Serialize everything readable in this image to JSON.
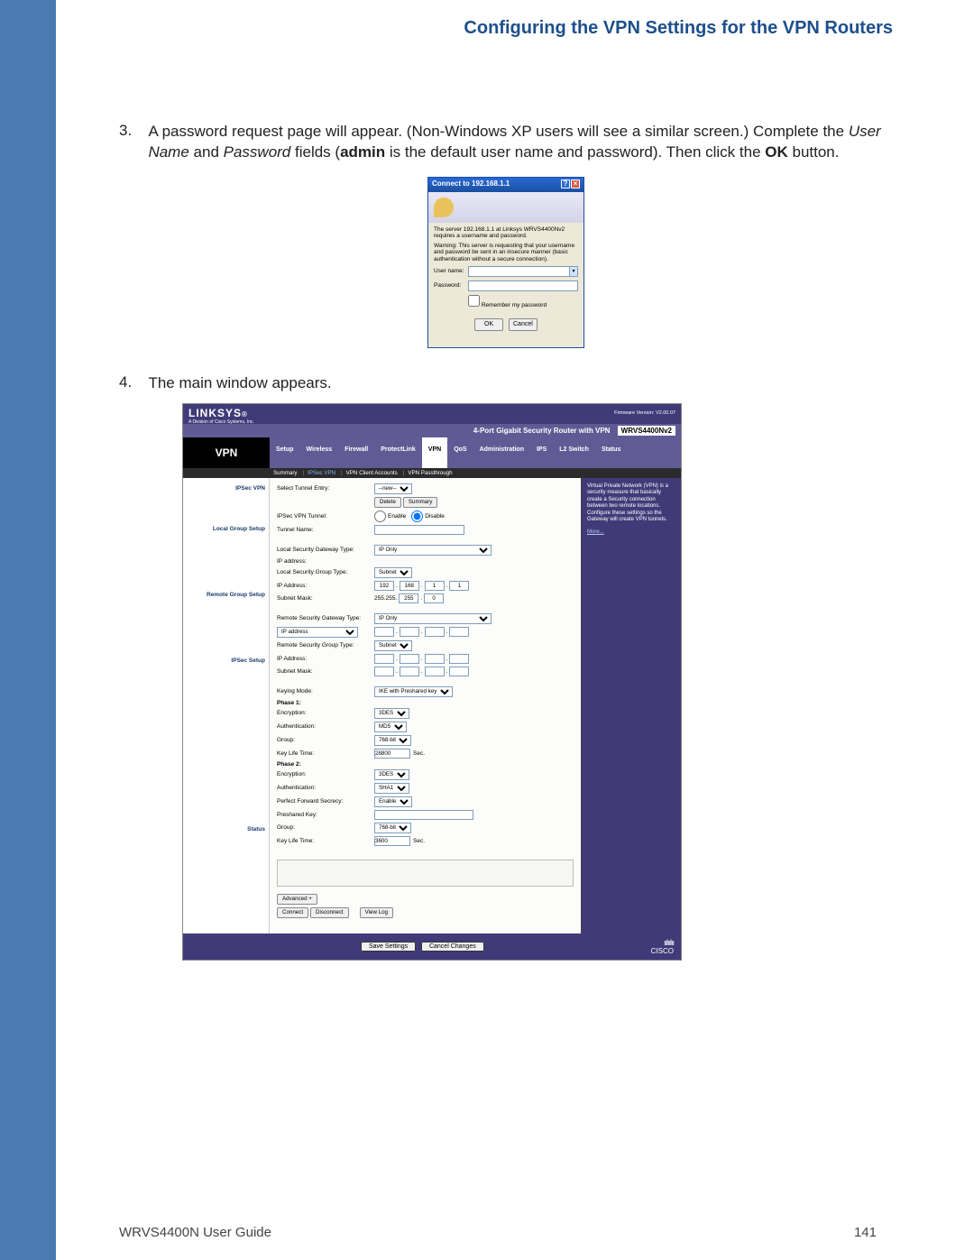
{
  "header": {
    "left": "",
    "right": "Configuring the VPN Settings for the VPN Routers"
  },
  "step3": {
    "num": "3.",
    "html": "A password request page will appear. (Non-Windows XP users will see a similar screen.) Complete the <i>User Name</i> and <i>Password</i> fields (<b>admin</b> is the default user name and password). Then click the <b>OK</b> button."
  },
  "xpdlg": {
    "title": "Connect to 192.168.1.1",
    "msg1": "The server 192.168.1.1 at Linksys WRVS4400Nv2 requires a username and password.",
    "msg2": "Warning: This server is requesting that your username and password be sent in an insecure manner (basic authentication without a secure connection).",
    "user_lbl": "User name:",
    "pass_lbl": "Password:",
    "remember": "Remember my password",
    "ok": "OK",
    "cancel": "Cancel"
  },
  "step4": {
    "num": "4.",
    "text": "The main window appears."
  },
  "router": {
    "brand": "LINKSYS",
    "brand_sub": "A Division of Cisco Systems, Inc.",
    "firmware": "Firmware Version: V2.00.07",
    "title": "4-Port Gigabit Security Router with VPN",
    "model": "WRVS4400Nv2",
    "logo": "VPN",
    "tabs": [
      "Setup",
      "Wireless",
      "Firewall",
      "ProtectLink",
      "VPN",
      "QoS",
      "Administration",
      "IPS",
      "L2 Switch",
      "Status"
    ],
    "active_tab": "VPN",
    "subtabs": [
      "Summary",
      "IPSec VPN",
      "VPN Client Accounts",
      "VPN Passthrough"
    ],
    "active_subtab": "IPSec VPN",
    "sections": {
      "ipsec": "IPSec VPN",
      "local": "Local Group Setup",
      "remote": "Remote Group Setup",
      "setup": "IPSec Setup",
      "status": "Status"
    },
    "fields": {
      "select_tunnel": "Select Tunnel Entry:",
      "tunnel_sel": "--new--",
      "delete": "Delete",
      "summary": "Summary",
      "ipsec_tunnel": "IPSec VPN Tunnel:",
      "enable": "Enable",
      "disable": "Disable",
      "tunnel_name": "Tunnel Name:",
      "local_gw_type": "Local Security Gateway Type:",
      "ip_only": "IP Only",
      "ip_address_lbl": "IP address:",
      "local_group_type": "Local Security Group Type:",
      "subnet": "Subnet",
      "ip_lbl": "IP Address:",
      "ip": [
        "192",
        "168",
        "1",
        "1"
      ],
      "mask_lbl": "Subnet Mask:",
      "mask_prefix": "255.255.",
      "mask": [
        "255",
        "0"
      ],
      "remote_gw_type": "Remote Security Gateway Type:",
      "ip_address_opt": "IP address",
      "remote_group_type": "Remote Security Group Type:",
      "keying": "Keying Mode:",
      "keying_val": "IKE with Preshared key",
      "phase1": "Phase 1:",
      "enc": "Encryption:",
      "enc1": "3DES",
      "auth": "Authentication:",
      "auth1": "MD5",
      "group": "Group:",
      "group1": "768-bit",
      "klt": "Key Life Time:",
      "klt1": "28800",
      "sec": "Sec.",
      "phase2": "Phase 2:",
      "enc2": "3DES",
      "auth2": "SHA1",
      "pfs": "Perfect Forward Secrecy:",
      "pfs_val": "Enable",
      "psk": "Preshared Key:",
      "group2": "768-bit",
      "klt2": "3600",
      "advanced": "Advanced +",
      "connect": "Connect",
      "disconnect": "Disconnect",
      "viewlog": "View Log"
    },
    "hint": "Virtual Private Network (VPN) is a security measure that basically create a Security connection between two remote locations. Configure these settings so the Gateway will create VPN tunnels.",
    "hint_more": "More...",
    "save": "Save Settings",
    "cancel": "Cancel Changes",
    "cisco": "CISCO"
  },
  "footer": {
    "left": "WRVS4400N User Guide",
    "right": "141"
  }
}
